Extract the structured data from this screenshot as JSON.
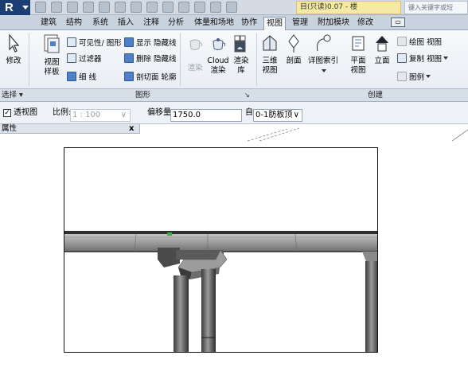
{
  "titlebar": {
    "document_title": "目(只读)0.07 - 楼",
    "search_placeholder": "键入关键字或短"
  },
  "tabs": [
    {
      "label": "建筑"
    },
    {
      "label": "结构"
    },
    {
      "label": "系统"
    },
    {
      "label": "插入"
    },
    {
      "label": "注释"
    },
    {
      "label": "分析"
    },
    {
      "label": "体量和场地"
    },
    {
      "label": "协作"
    },
    {
      "label": "视图",
      "active": true
    },
    {
      "label": "管理"
    },
    {
      "label": "附加模块"
    },
    {
      "label": "修改"
    }
  ],
  "ribbon": {
    "modify": "修改",
    "view_templates": {
      "line1": "视图",
      "line2": "样板"
    },
    "visibility_graphics": "可见性/ 图形",
    "filters": "过滤器",
    "thin_lines": "细 线",
    "show_hidden_lines": "显示 隐藏线",
    "remove_hidden_lines": "删除 隐藏线",
    "cut_profile": "剖切面 轮廓",
    "render": "渲染",
    "cloud_render": {
      "line1": "Cloud",
      "line2": "渲染"
    },
    "render_gallery": {
      "line1": "渲染",
      "line2": "库"
    },
    "view_3d": {
      "line1": "三维",
      "line2": "视图"
    },
    "section": "剖面",
    "callout": "详图索引",
    "plan_view": {
      "line1": "平面",
      "line2": "视图"
    },
    "elevation": "立面",
    "drafting_view": "绘图 视图",
    "duplicate_view": "复制 视图",
    "legends": "图例"
  },
  "panel_labels": {
    "select": "选择",
    "graphics": "图形",
    "create": "创建"
  },
  "options_bar": {
    "perspective_checked": true,
    "perspective_label": "透视图",
    "scale_label": "比例:",
    "scale_value": "1 : 100",
    "offset_label": "偏移量:",
    "offset_value": "1750.0",
    "from_label": "自",
    "from_value": "0-1肪板顶"
  },
  "properties": {
    "header": "属性",
    "close": "x"
  }
}
